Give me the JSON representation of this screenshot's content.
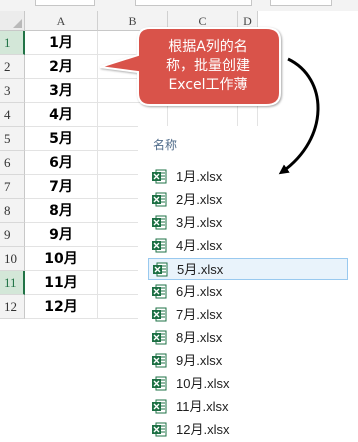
{
  "columns": [
    "A",
    "B",
    "C",
    "D"
  ],
  "rows": [
    {
      "num": "1",
      "a": "1月",
      "selected": true
    },
    {
      "num": "2",
      "a": "2月",
      "selected": false
    },
    {
      "num": "3",
      "a": "3月",
      "selected": false
    },
    {
      "num": "4",
      "a": "4月",
      "selected": false
    },
    {
      "num": "5",
      "a": "5月",
      "selected": false
    },
    {
      "num": "6",
      "a": "6月",
      "selected": false
    },
    {
      "num": "7",
      "a": "7月",
      "selected": false
    },
    {
      "num": "8",
      "a": "8月",
      "selected": false
    },
    {
      "num": "9",
      "a": "9月",
      "selected": false
    },
    {
      "num": "10",
      "a": "10月",
      "selected": false
    },
    {
      "num": "11",
      "a": "11月",
      "selected": true
    },
    {
      "num": "12",
      "a": "12月",
      "selected": false
    }
  ],
  "callout": {
    "lines": [
      "根据A列的名",
      "称，批量创建",
      "Excel工作薄"
    ],
    "fill_color": "#d9534a",
    "border_color": "#ffffff"
  },
  "file_panel": {
    "header": "名称",
    "files": [
      {
        "name": "1月.xlsx",
        "selected": false
      },
      {
        "name": "2月.xlsx",
        "selected": false
      },
      {
        "name": "3月.xlsx",
        "selected": false
      },
      {
        "name": "4月.xlsx",
        "selected": false
      },
      {
        "name": "5月.xlsx",
        "selected": true
      },
      {
        "name": "6月.xlsx",
        "selected": false
      },
      {
        "name": "7月.xlsx",
        "selected": false
      },
      {
        "name": "8月.xlsx",
        "selected": false
      },
      {
        "name": "9月.xlsx",
        "selected": false
      },
      {
        "name": "10月.xlsx",
        "selected": false
      },
      {
        "name": "11月.xlsx",
        "selected": false
      },
      {
        "name": "12月.xlsx",
        "selected": false
      }
    ],
    "icon": "excel-file-icon",
    "icon_color": "#1d7044"
  },
  "accent_colors": {
    "selected_row_header": "#d3e7d8",
    "selected_file_border": "#99c9ef"
  }
}
